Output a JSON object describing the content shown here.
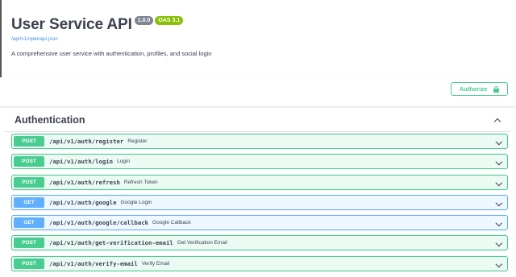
{
  "info": {
    "title": "User Service API",
    "version_badge": "1.0.0",
    "oas_badge": "OAS 3.1",
    "spec_link": "/api/v1/openapi.json",
    "description": "A comprehensive user service with authentication, profiles, and social login"
  },
  "authorize": {
    "label": "Authorize",
    "icon": "lock-icon"
  },
  "tag": {
    "title": "Authentication",
    "icon": "chevron-up-icon"
  },
  "operations": [
    {
      "method": "POST",
      "path": "/api/v1/auth/register",
      "summary": "Register"
    },
    {
      "method": "POST",
      "path": "/api/v1/auth/login",
      "summary": "Login"
    },
    {
      "method": "POST",
      "path": "/api/v1/auth/refresh",
      "summary": "Refresh Token"
    },
    {
      "method": "GET",
      "path": "/api/v1/auth/google",
      "summary": "Google Login"
    },
    {
      "method": "GET",
      "path": "/api/v1/auth/google/callback",
      "summary": "Google Callback"
    },
    {
      "method": "POST",
      "path": "/api/v1/auth/get-verification-email",
      "summary": "Get Verification Email"
    },
    {
      "method": "POST",
      "path": "/api/v1/auth/verify-email",
      "summary": "Verify Email"
    }
  ],
  "colors": {
    "post": "#49cc90",
    "get": "#61affe",
    "text": "#3b4151",
    "link": "#4990e2"
  }
}
